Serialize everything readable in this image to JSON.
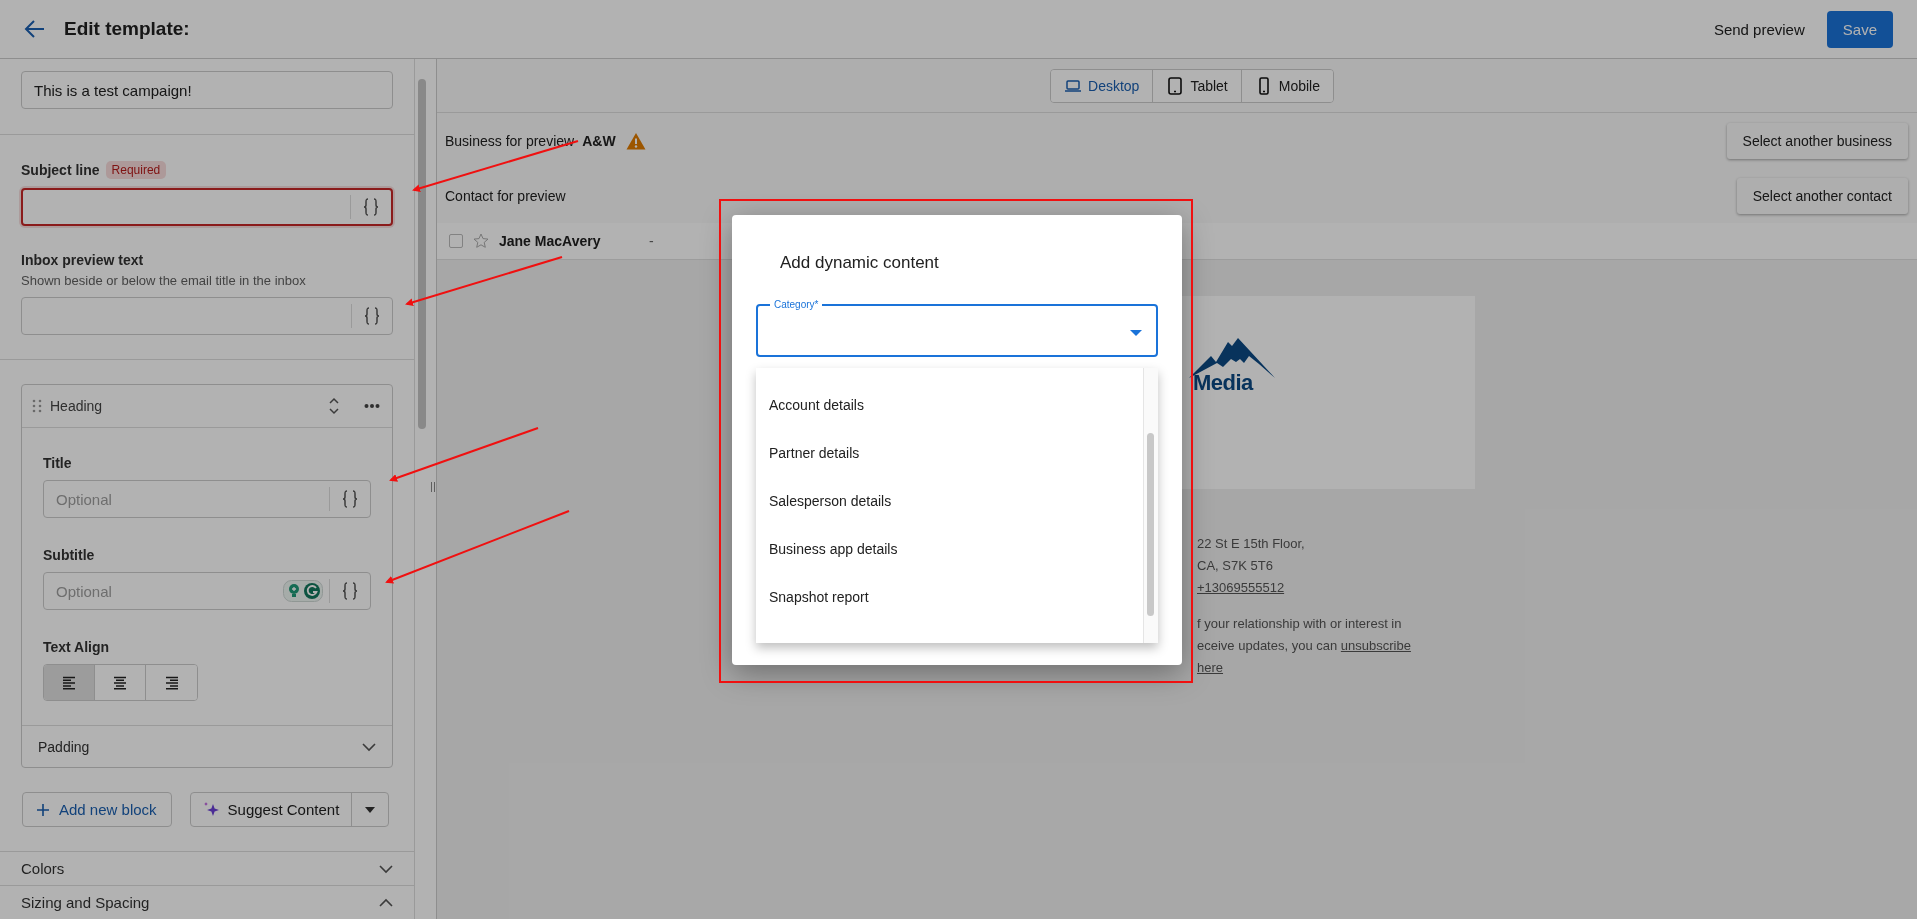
{
  "header": {
    "title": "Edit template:",
    "actions": [
      {
        "label": "Send preview",
        "kind": "text"
      },
      {
        "label": "Save",
        "kind": "primary"
      }
    ]
  },
  "sidebar": {
    "campaign_field": {
      "value": "This is a test campaign!"
    },
    "subject_line": {
      "label": "Subject line",
      "badge": "Required",
      "error": true
    },
    "inbox_preview": {
      "label": "Inbox preview text",
      "hint": "Shown beside or below the email title in the inbox",
      "error": false
    },
    "heading_block": {
      "title": "Heading",
      "fields": [
        {
          "label": "Title",
          "placeholder": "Optional",
          "assistant": false
        },
        {
          "label": "Subtitle",
          "placeholder": "Optional",
          "assistant": true
        }
      ],
      "text_align": {
        "label": "Text Align",
        "options": [
          {
            "kind": "left",
            "selected": true
          },
          {
            "kind": "center",
            "selected": false
          },
          {
            "kind": "right",
            "selected": false
          }
        ]
      },
      "padding": {
        "label": "Padding",
        "expanded": false
      }
    },
    "add_block": "Add new block",
    "suggest": "Suggest Content",
    "sections": [
      {
        "label": "Colors",
        "expanded": false
      },
      {
        "label": "Sizing and Spacing",
        "expanded": true
      }
    ]
  },
  "preview": {
    "devices": [
      {
        "label": "Desktop",
        "kind": "laptop",
        "selected": true
      },
      {
        "label": "Tablet",
        "kind": "tablet",
        "selected": false
      },
      {
        "label": "Mobile",
        "kind": "phone",
        "selected": false
      }
    ],
    "business": {
      "label": "Business for preview",
      "value": "A&W",
      "warning": true,
      "button": "Select another business"
    },
    "contact": {
      "label": "Contact for preview",
      "button": "Select another contact",
      "row": {
        "name": "Jane MacAvery",
        "column_2": "-",
        "checked": false,
        "starred": false
      }
    },
    "email": {
      "logo_text": "Media",
      "address_lines": [
        "22 St E 15th Floor,",
        "CA, S7K 5T6"
      ],
      "phone": "+13069555512",
      "footer_line_1": "f your relationship with or interest in",
      "footer_line_2": "eceive updates, you can",
      "unsubscribe": "unsubscribe",
      "here": "here"
    }
  },
  "dialog": {
    "title": "Add dynamic content",
    "field": {
      "label": "Category*"
    },
    "options": [
      "Account details",
      "Partner details",
      "Salesperson details",
      "Business app details",
      "Snapshot report"
    ]
  }
}
